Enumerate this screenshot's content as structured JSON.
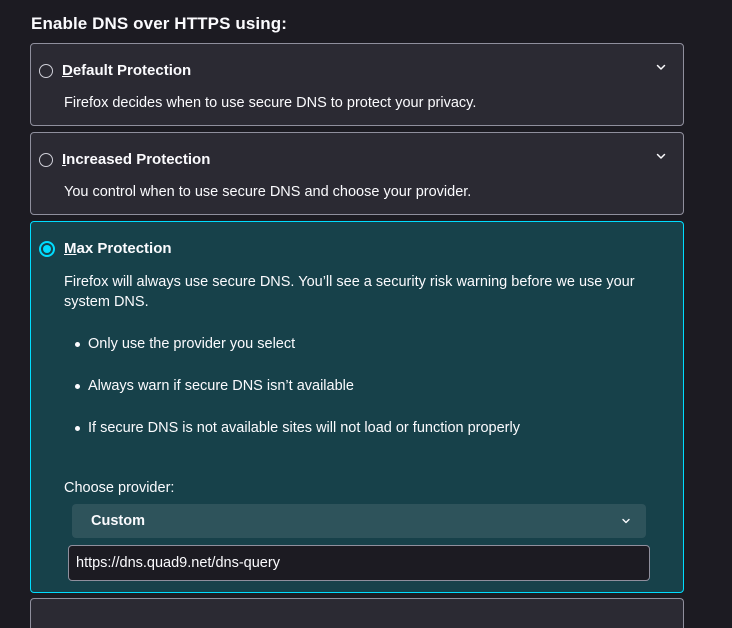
{
  "section": {
    "title": "Enable DNS over HTTPS using:"
  },
  "options": [
    {
      "accesskey": "D",
      "title_rest": "efault Protection",
      "description": "Firefox decides when to use secure DNS to protect your privacy.",
      "selected": false
    },
    {
      "accesskey": "I",
      "title_rest": "ncreased Protection",
      "description": "You control when to use secure DNS and choose your provider.",
      "selected": false
    },
    {
      "accesskey": "M",
      "title_rest": "ax Protection",
      "description": "Firefox will always use secure DNS. You’ll see a security risk warning before we use your system DNS.",
      "selected": true,
      "bullets": [
        "Only use the provider you select",
        "Always warn if secure DNS isn’t available",
        "If secure DNS is not available sites will not load or function properly"
      ],
      "provider_label": "Choose provider:",
      "provider_selected": "Custom",
      "custom_url": "https://dns.quad9.net/dns-query"
    }
  ],
  "colors": {
    "background": "#1c1b22",
    "card": "#2b2a33",
    "selected_card": "#17414a",
    "accent": "#00ddff",
    "select_bg": "#2e535b"
  },
  "icons": {
    "expand": "chevron-down-icon"
  }
}
